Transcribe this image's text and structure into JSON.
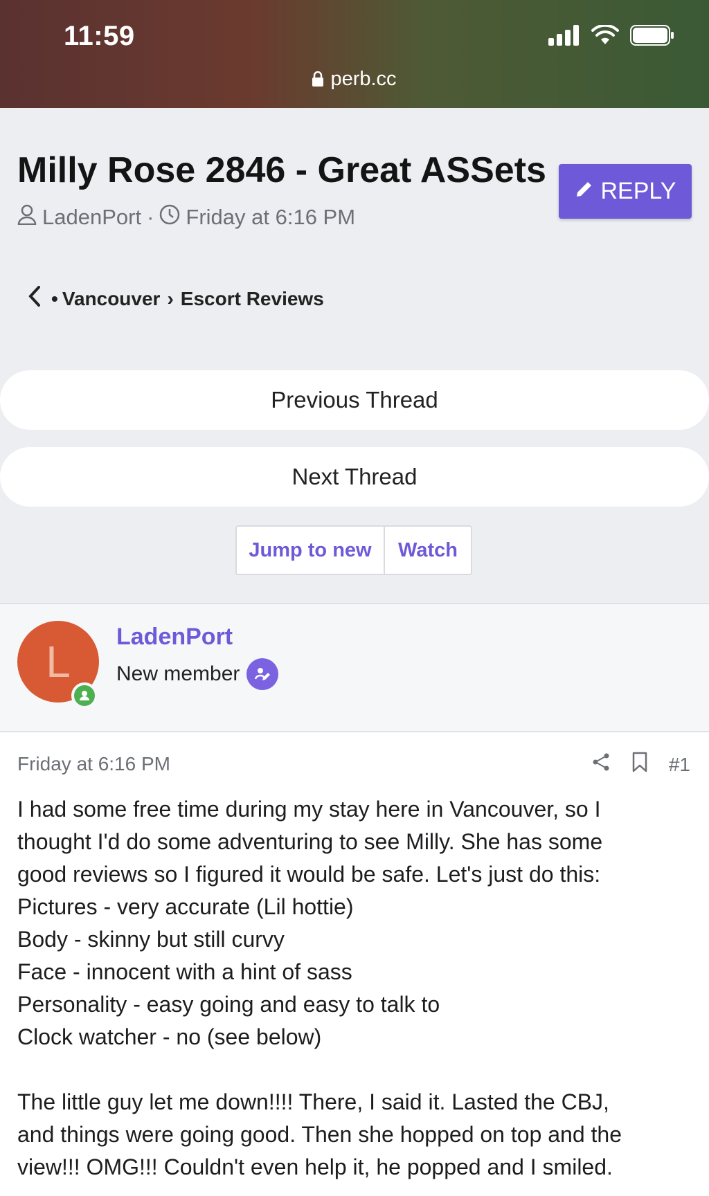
{
  "status_bar": {
    "time": "11:59",
    "url": "perb.cc"
  },
  "thread": {
    "title": "Milly Rose 2846 - Great ASSets",
    "author": "LadenPort",
    "separator": "·",
    "date": "Friday at 6:16 PM",
    "reply_label": "REPLY"
  },
  "breadcrumb": {
    "bullet": "•",
    "forum": "Vancouver",
    "arrow": "›",
    "section": "Escort Reviews"
  },
  "navigation": {
    "previous": "Previous Thread",
    "next": "Next Thread"
  },
  "actions": {
    "jump_to_new": "Jump to new",
    "watch": "Watch"
  },
  "user": {
    "avatar_letter": "L",
    "name": "LadenPort",
    "title": "New member"
  },
  "post": {
    "date": "Friday at 6:16 PM",
    "number": "#1",
    "paragraph1": [
      "I had some free time during my stay here in Vancouver, so I",
      "thought I'd do some adventuring to see Milly. She has some",
      "good reviews so I figured it would be safe. Let's just do this:",
      "Pictures - very accurate (Lil hottie)",
      "Body - skinny but still curvy",
      "Face - innocent with a hint of sass",
      "Personality - easy going and easy to talk to",
      "Clock watcher - no (see below)"
    ],
    "paragraph2": [
      "The little guy let me down!!!! There, I said it. Lasted the CBJ,",
      "and things were going good. Then she hopped on top and the",
      "view!!! OMG!!! Couldn't even help it, he popped and I smiled."
    ]
  },
  "colors": {
    "accent": "#6e5ad8",
    "avatar": "#d85a34",
    "online": "#4caf50"
  }
}
